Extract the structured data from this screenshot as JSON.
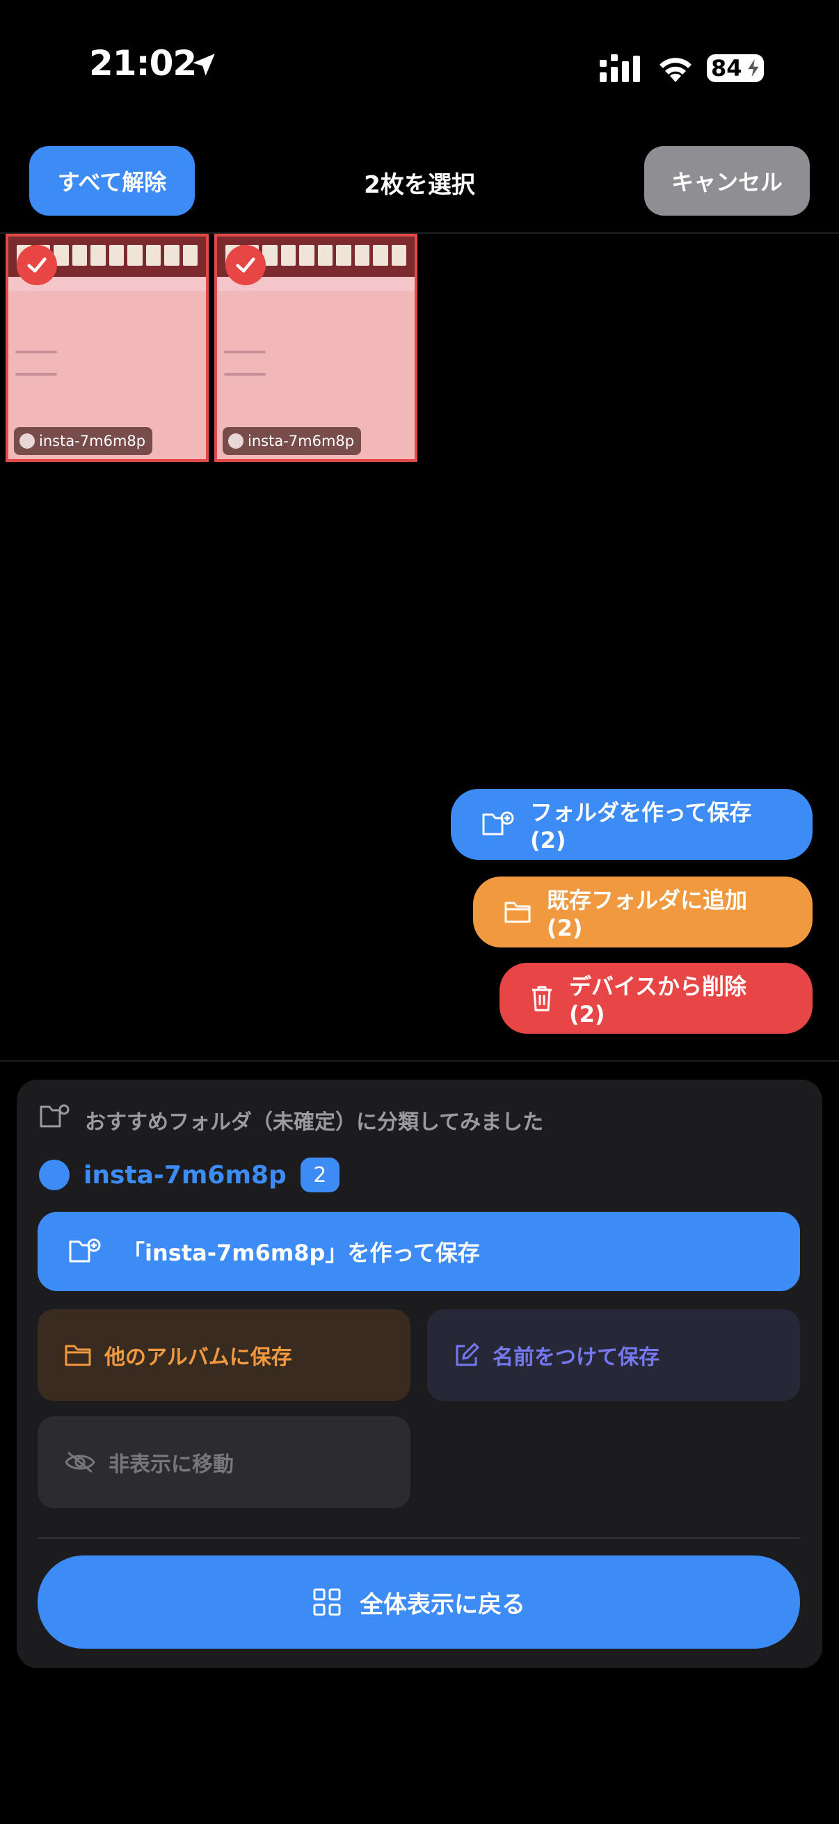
{
  "status_bar": {
    "time": "21:02",
    "battery": "84"
  },
  "header": {
    "deselect_label": "すべて解除",
    "title": "2枚を選択",
    "cancel_label": "キャンセル"
  },
  "thumbnails": [
    {
      "tag": "insta-7m6m8p"
    },
    {
      "tag": "insta-7m6m8p"
    }
  ],
  "actions": {
    "create_folder": "フォルダを作って保存 (2)",
    "add_existing": "既存フォルダに追加 (2)",
    "delete_device": "デバイスから削除 (2)"
  },
  "suggestion": {
    "title": "おすすめフォルダ（未確定）に分類してみました",
    "person": "insta-7m6m8p",
    "count": "2",
    "primary": "「insta-7m6m8p」を作って保存",
    "other_album": "他のアルバムに保存",
    "name_save": "名前をつけて保存",
    "hide": "非表示に移動",
    "back": "全体表示に戻る"
  },
  "colors": {
    "accent": "#3d8bf5",
    "orange": "#f0993f",
    "danger": "#e84646",
    "panel": "#1c1c1e"
  }
}
